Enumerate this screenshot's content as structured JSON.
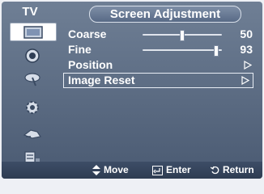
{
  "header": {
    "menu_title": "TV",
    "screen_title": "Screen Adjustment"
  },
  "sidebar": {
    "items": [
      {
        "icon": "picture-icon",
        "active": true
      },
      {
        "icon": "sound-icon",
        "active": false
      },
      {
        "icon": "channel-icon",
        "active": false
      },
      {
        "icon": "setup-icon",
        "active": false
      },
      {
        "icon": "input-icon",
        "active": false
      },
      {
        "icon": "digital-menu-icon",
        "active": false
      }
    ]
  },
  "settings": {
    "coarse": {
      "label": "Coarse",
      "value": "50",
      "level": 0.5
    },
    "fine": {
      "label": "Fine",
      "value": "93",
      "level": 0.93
    },
    "position": {
      "label": "Position"
    },
    "image_reset": {
      "label": "Image Reset"
    }
  },
  "footer": {
    "move": "Move",
    "enter": "Enter",
    "return": "Return"
  },
  "colors": {
    "background": "#4a5a72",
    "footer": "#2e3c52",
    "text": "#ffffff"
  }
}
